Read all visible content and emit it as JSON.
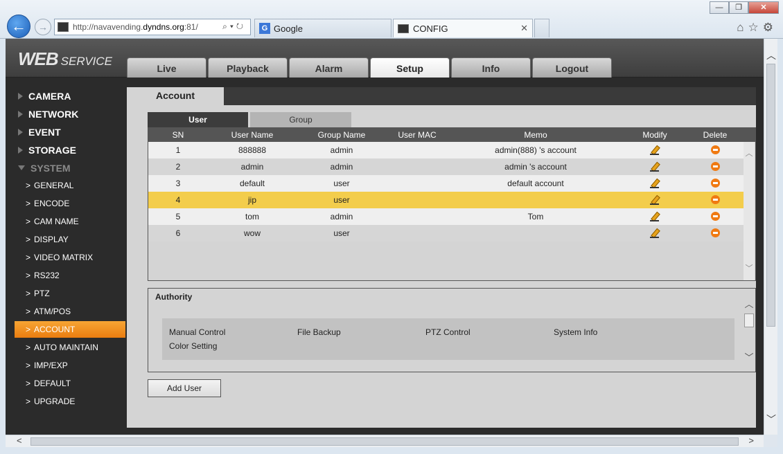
{
  "browser": {
    "url_prefix": "http://navavending.",
    "url_host": "dyndns.org",
    "url_suffix": ":81/",
    "addr_tools": "⌕▾↻",
    "tabs": [
      {
        "label": "Google",
        "icon": "G"
      },
      {
        "label": "CONFIG"
      }
    ],
    "close_glyph": "✕",
    "window_buttons": [
      "—",
      "❐",
      "✕"
    ],
    "right_icons": "⌂☆⚙"
  },
  "app": {
    "logo_main": "WEB",
    "logo_sub": "SERVICE",
    "nav": [
      "Live",
      "Playback",
      "Alarm",
      "Setup",
      "Info",
      "Logout"
    ],
    "active_nav": "Setup"
  },
  "sidebar": {
    "categories": [
      "CAMERA",
      "NETWORK",
      "EVENT",
      "STORAGE",
      "SYSTEM"
    ],
    "system_items": [
      "GENERAL",
      "ENCODE",
      "CAM NAME",
      "DISPLAY",
      "VIDEO MATRIX",
      "RS232",
      "PTZ",
      "ATM/POS",
      "ACCOUNT",
      "AUTO MAINTAIN",
      "IMP/EXP",
      "DEFAULT",
      "UPGRADE"
    ],
    "active_item": "ACCOUNT",
    "chevron": ">"
  },
  "account": {
    "tab_label": "Account",
    "subtabs": [
      "User",
      "Group"
    ],
    "columns": [
      "SN",
      "User Name",
      "Group Name",
      "User MAC",
      "Memo",
      "Modify",
      "Delete"
    ],
    "rows": [
      {
        "sn": "1",
        "name": "888888",
        "group": "admin",
        "mac": "",
        "memo": "admin(888) 's account"
      },
      {
        "sn": "2",
        "name": "admin",
        "group": "admin",
        "mac": "",
        "memo": "admin 's account"
      },
      {
        "sn": "3",
        "name": "default",
        "group": "user",
        "mac": "",
        "memo": "default account"
      },
      {
        "sn": "4",
        "name": "jip",
        "group": "user",
        "mac": "",
        "memo": ""
      },
      {
        "sn": "5",
        "name": "tom",
        "group": "admin",
        "mac": "",
        "memo": "Tom"
      },
      {
        "sn": "6",
        "name": "wow",
        "group": "user",
        "mac": "",
        "memo": ""
      }
    ],
    "selected_row": 3,
    "authority_title": "Authority",
    "permissions": [
      "Manual Control",
      "File Backup",
      "PTZ Control",
      "System Info",
      "Color Setting"
    ],
    "add_user_label": "Add User"
  },
  "colors": {
    "selected_row": "#f3cd4c",
    "active_sidebar": "#f39220",
    "delete_icon": "#f07a12"
  }
}
